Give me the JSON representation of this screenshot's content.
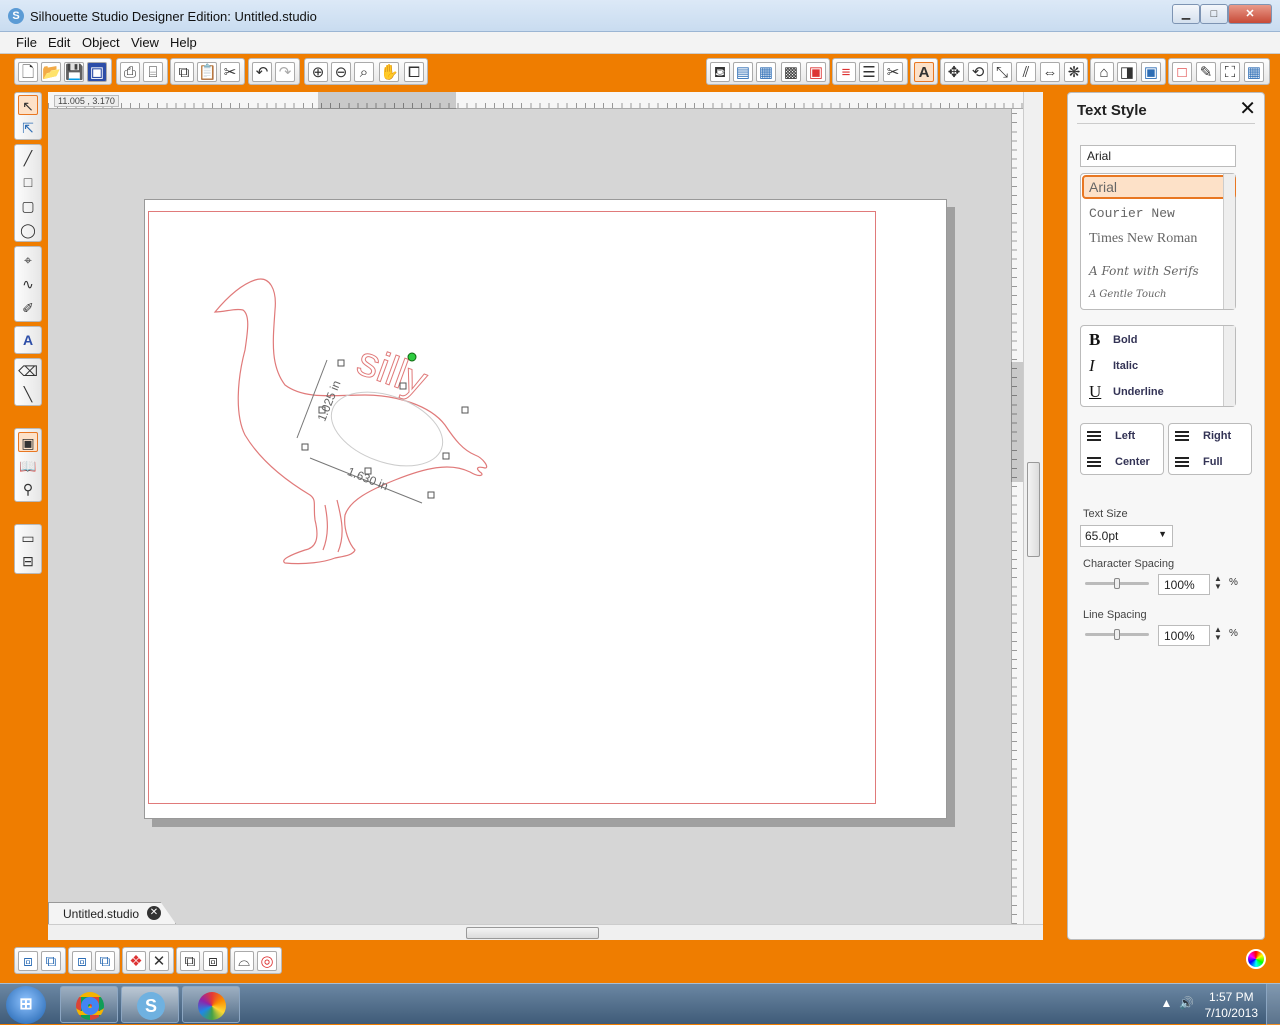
{
  "window": {
    "title": "Silhouette Studio Designer Edition: Untitled.studio",
    "minimize": "▁",
    "maximize": "□",
    "close": "✕"
  },
  "menu": [
    "File",
    "Edit",
    "Object",
    "View",
    "Help"
  ],
  "toolbar_icons": [
    "new-doc-icon",
    "open-icon",
    "save-icon",
    "save-library-icon",
    "print-icon",
    "send-to-cutter-icon",
    "copy-icon",
    "paste-icon",
    "cut-icon",
    "undo-icon",
    "redo-icon",
    "zoom-in-icon",
    "zoom-out-icon",
    "zoom-select-icon",
    "pan-icon",
    "fit-page-icon"
  ],
  "workspace": {
    "coords": "11.005 , 3.170",
    "tab_label": "Untitled.studio"
  },
  "design": {
    "text": "silly",
    "height_label": "1.025 in",
    "width_label": "1.630 in",
    "line_color": "#e07a7a"
  },
  "panel": {
    "title": "Text Style",
    "font_value": "Arial",
    "fonts": [
      "Arial",
      "Courier New",
      "Times New Roman",
      "A Font with Serifs",
      "A Gentle Touch"
    ],
    "styles": [
      {
        "icon": "B",
        "label": "Bold"
      },
      {
        "icon": "I",
        "label": "Italic"
      },
      {
        "icon": "U",
        "label": "Underline"
      }
    ],
    "align_left": [
      "Left",
      "Center"
    ],
    "align_right": [
      "Right",
      "Full"
    ],
    "text_size_label": "Text Size",
    "text_size": "65.0pt",
    "char_spacing_label": "Character Spacing",
    "char_spacing": "100%",
    "char_spacing_level": 0.5,
    "line_spacing_label": "Line Spacing",
    "line_spacing": "100%",
    "line_spacing_level": 0.5,
    "pct": "%"
  },
  "taskbar": {
    "time": "1:57 PM",
    "date": "7/10/2013"
  },
  "colors": {
    "accent": "#ef7d00",
    "cut_line": "#e07a7a",
    "selected_font_bg": "#fde1c8"
  }
}
